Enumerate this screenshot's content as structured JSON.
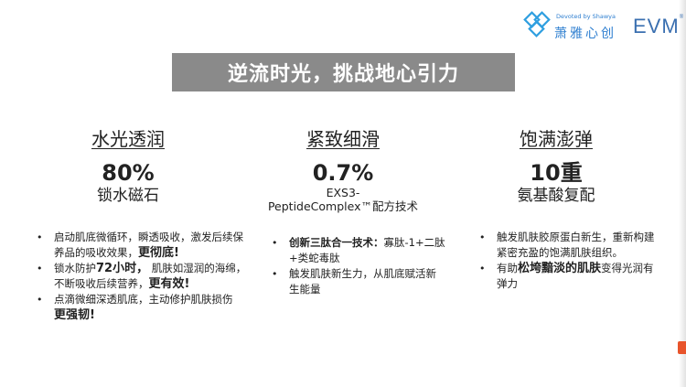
{
  "header": {
    "logo_en": "Devoted by Shawya",
    "logo_cn": "萧雅心创",
    "evm_logo": "EVM"
  },
  "title": "逆流时光，挑战地心引力",
  "columns": [
    {
      "heading": "水光透润",
      "figure": "80%",
      "subtitle": "锁水磁石"
    },
    {
      "heading": "紧致细滑",
      "figure": "0.7%",
      "subtitle_line1": "EXS3-",
      "subtitle_line2": "PeptideComplex™配方技术"
    },
    {
      "heading": "饱满澎弹",
      "figure": "10重",
      "subtitle": "氨基酸复配"
    }
  ],
  "bullets": {
    "col1": [
      {
        "pre": "启动肌底微循环，瞬透吸收，激发后续保养品的吸收效果，",
        "strong": "更彻底!",
        "post": ""
      },
      {
        "pre": "锁水防护",
        "strong": "72小时，",
        "mid": "肌肤如湿润的海绵，不断吸收后续营养，",
        "strong2": "更有效!"
      },
      {
        "pre": "点滴微细深透肌底，主动修护肌肤损伤 ",
        "strong": "更强韧!",
        "post": ""
      }
    ],
    "col2": [
      {
        "strong": "创新三肽合一技术：",
        "post": "寡肽-1+二肽+类蛇毒肽"
      },
      {
        "pre": "触发肌肤新生力，从肌底赋活新生能量"
      }
    ],
    "col3": [
      {
        "pre": "触发肌肤胶原蛋白新生，重新构建紧密充盈的饱满肌肤组织。"
      },
      {
        "pre": "有助",
        "strong": "松垮黯淡的肌肤",
        "post": "变得光润有弹力"
      }
    ]
  },
  "colors": {
    "banner": "#8a8a8a",
    "logo_blue": "#2f7fd0",
    "accent_orange": "#e8542b"
  }
}
